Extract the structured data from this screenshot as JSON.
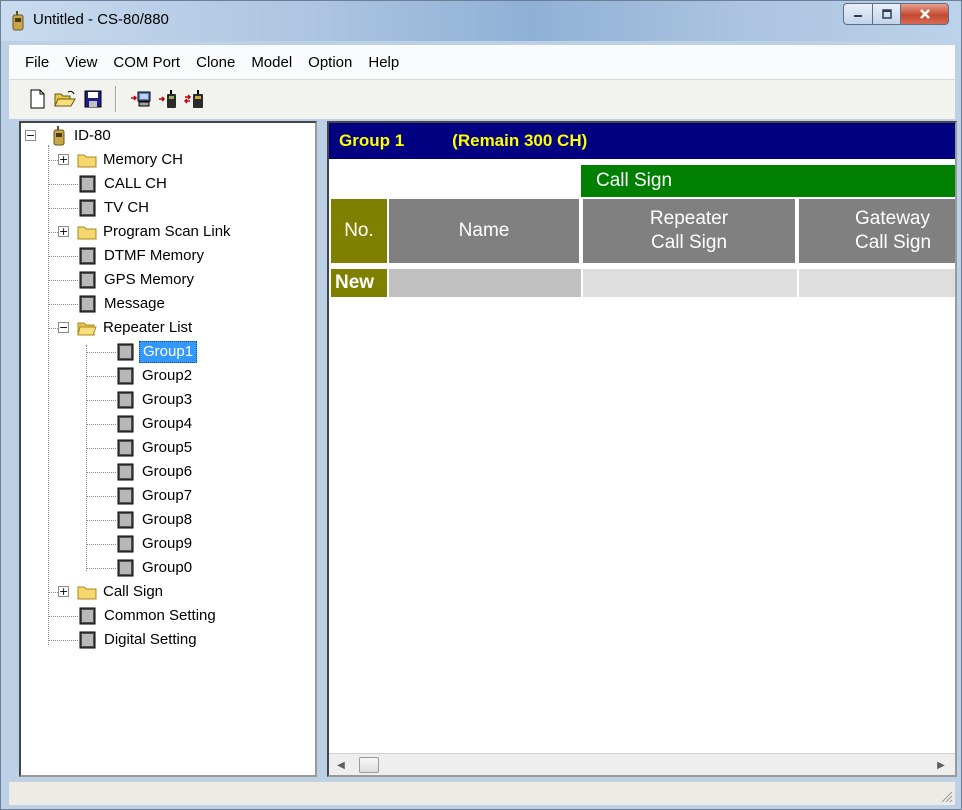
{
  "window": {
    "title": "Untitled - CS-80/880"
  },
  "menu": [
    "File",
    "View",
    "COM Port",
    "Clone",
    "Model",
    "Option",
    "Help"
  ],
  "toolbar": {
    "buttons": [
      "new-icon",
      "open-icon",
      "save-icon",
      "read-from-radio-icon",
      "write-to-radio-icon",
      "clone-radio-icon"
    ]
  },
  "tree": {
    "root": "ID-80",
    "items": {
      "memory_ch": "Memory CH",
      "call_ch": "CALL CH",
      "tv_ch": "TV CH",
      "program_scan_link": "Program Scan Link",
      "dtmf_memory": "DTMF Memory",
      "gps_memory": "GPS Memory",
      "message": "Message",
      "repeater_list": "Repeater List",
      "call_sign": "Call Sign",
      "common_setting": "Common Setting",
      "digital_setting": "Digital Setting"
    },
    "groups": [
      "Group1",
      "Group2",
      "Group3",
      "Group4",
      "Group5",
      "Group6",
      "Group7",
      "Group8",
      "Group9",
      "Group0"
    ],
    "selected": "Group1"
  },
  "grid": {
    "group_label": "Group 1",
    "remain_label": "(Remain 300 CH)",
    "call_sign_header": "Call Sign",
    "columns": {
      "no": "No.",
      "name": "Name",
      "repeater_line1": "Repeater",
      "repeater_line2": "Call Sign",
      "gateway_line1": "Gateway",
      "gateway_line2": "Call Sign"
    },
    "new_row_label": "New"
  },
  "colors": {
    "header_bg": "#000080",
    "header_text": "#ffff00",
    "call_sign_bg": "#008000",
    "column_bg": "#808080",
    "no_column_bg": "#808000",
    "selection": "#3399ff"
  }
}
